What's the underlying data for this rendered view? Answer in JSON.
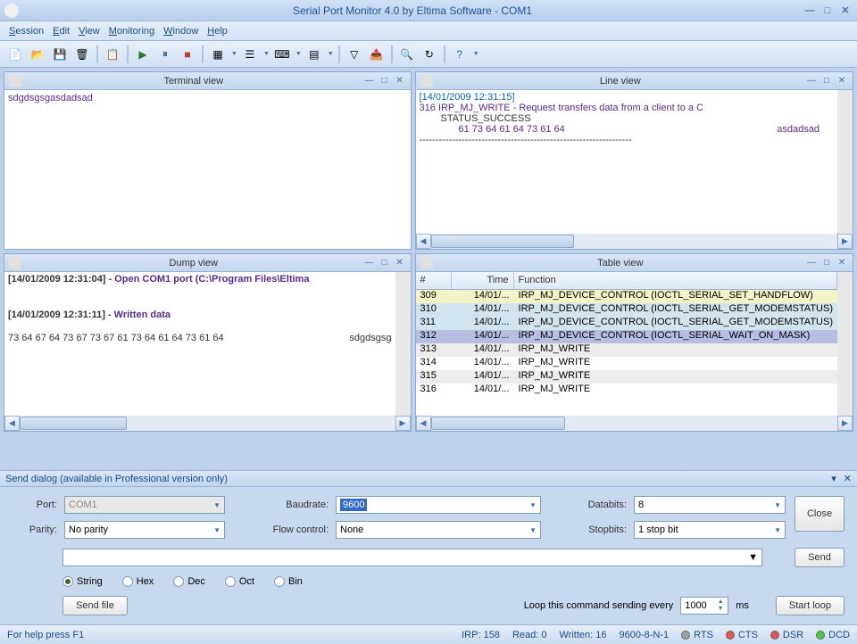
{
  "window": {
    "title": "Serial Port Monitor 4.0 by Eltima Software - COM1"
  },
  "menu": {
    "session": "Session",
    "edit": "Edit",
    "view": "View",
    "monitoring": "Monitoring",
    "window": "Window",
    "help": "Help"
  },
  "panes": {
    "terminal": {
      "title": "Terminal view",
      "content": "sdgdsgsgasdadsad"
    },
    "line": {
      "title": "Line view",
      "ts": "[14/01/2009 12:31:15]",
      "l1": "316   IRP_MJ_WRITE - Request transfers data from a client to a C",
      "l2": "STATUS_SUCCESS",
      "l3": "61 73 64 61 64 73 61 64",
      "l3r": "asdadsad"
    },
    "dump": {
      "title": "Dump view",
      "l1a": "[14/01/2009 12:31:04]",
      "l1b": " - Open COM1 port (C:\\Program Files\\Eltima",
      "l2a": "[14/01/2009 12:31:11]",
      "l2b": " - Written data",
      "hex": "73 64 67 64 73 67 73 67 61 73 64 61 64 73 61 64",
      "hexr": "sdgdsgsg"
    },
    "table": {
      "title": "Table view",
      "cols": {
        "n": "#",
        "time": "Time",
        "func": "Function"
      },
      "rows": [
        {
          "n": "309",
          "t": "14/01/...",
          "f": "IRP_MJ_DEVICE_CONTROL (IOCTL_SERIAL_SET_HANDFLOW)"
        },
        {
          "n": "310",
          "t": "14/01/...",
          "f": "IRP_MJ_DEVICE_CONTROL (IOCTL_SERIAL_GET_MODEMSTATUS)"
        },
        {
          "n": "311",
          "t": "14/01/...",
          "f": "IRP_MJ_DEVICE_CONTROL (IOCTL_SERIAL_GET_MODEMSTATUS)"
        },
        {
          "n": "312",
          "t": "14/01/...",
          "f": "IRP_MJ_DEVICE_CONTROL (IOCTL_SERIAL_WAIT_ON_MASK)"
        },
        {
          "n": "313",
          "t": "14/01/...",
          "f": "IRP_MJ_WRITE"
        },
        {
          "n": "314",
          "t": "14/01/...",
          "f": "IRP_MJ_WRITE"
        },
        {
          "n": "315",
          "t": "14/01/...",
          "f": "IRP_MJ_WRITE"
        },
        {
          "n": "316",
          "t": "14/01/...",
          "f": "IRP_MJ_WRITE"
        }
      ]
    }
  },
  "send": {
    "header": "Send dialog (available in Professional version only)",
    "port_lbl": "Port:",
    "port_val": "COM1",
    "baud_lbl": "Baudrate:",
    "baud_val": "9600",
    "databits_lbl": "Databits:",
    "databits_val": "8",
    "parity_lbl": "Parity:",
    "parity_val": "No parity",
    "flow_lbl": "Flow control:",
    "flow_val": "None",
    "stopbits_lbl": "Stopbits:",
    "stopbits_val": "1 stop bit",
    "close_btn": "Close",
    "send_btn": "Send",
    "sendfile_btn": "Send file",
    "startloop_btn": "Start loop",
    "r_string": "String",
    "r_hex": "Hex",
    "r_dec": "Dec",
    "r_oct": "Oct",
    "r_bin": "Bin",
    "loop_lbl": "Loop this command sending every",
    "loop_val": "1000",
    "loop_unit": "ms"
  },
  "status": {
    "help": "For help press F1",
    "irp": "IRP: 158",
    "read": "Read: 0",
    "written": "Written: 16",
    "mode": "9600-8-N-1",
    "rts": "RTS",
    "cts": "CTS",
    "dsr": "DSR",
    "dcd": "DCD"
  }
}
